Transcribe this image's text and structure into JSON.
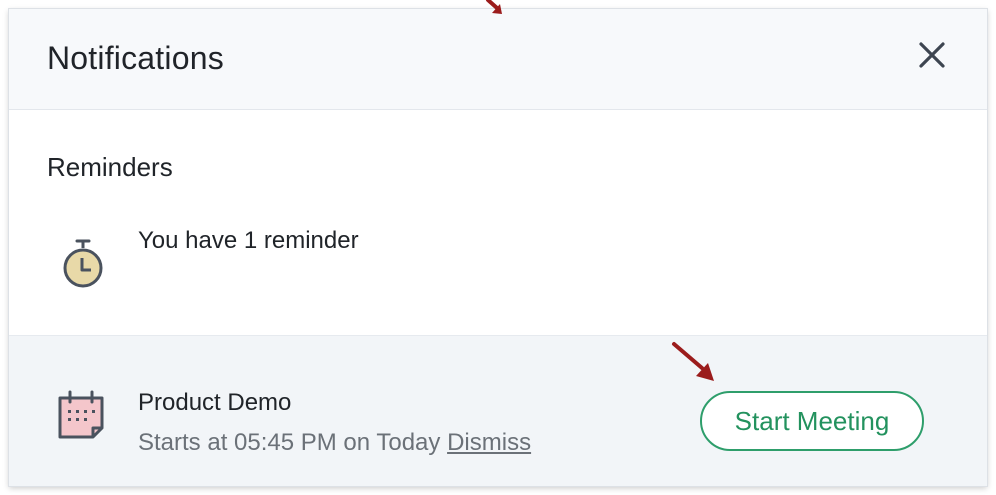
{
  "panel": {
    "title": "Notifications",
    "close_icon": "close-icon"
  },
  "reminders": {
    "section_title": "Reminders",
    "summary": "You have 1 reminder",
    "icon": "stopwatch-icon",
    "icon_color": "#e8d9a8"
  },
  "event": {
    "title": "Product Demo",
    "meta_text": "Starts at 05:45 PM on Today ",
    "dismiss_label": "Dismiss",
    "icon": "calendar-icon",
    "icon_color": "#f4c6cb",
    "start_button_label": "Start Meeting"
  },
  "colors": {
    "accent_green": "#2e9e6b",
    "annotation_arrow": "#9b1c1c"
  }
}
